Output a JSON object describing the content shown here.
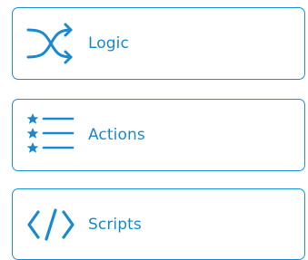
{
  "menu": {
    "items": [
      {
        "label": "Logic",
        "icon": "shuffle-icon"
      },
      {
        "label": "Actions",
        "icon": "starred-list-icon"
      },
      {
        "label": "Scripts",
        "icon": "code-brackets-icon"
      }
    ]
  },
  "colors": {
    "accent": "#1a8ad0",
    "border": "#1a90d6",
    "background": "#ffffff"
  }
}
